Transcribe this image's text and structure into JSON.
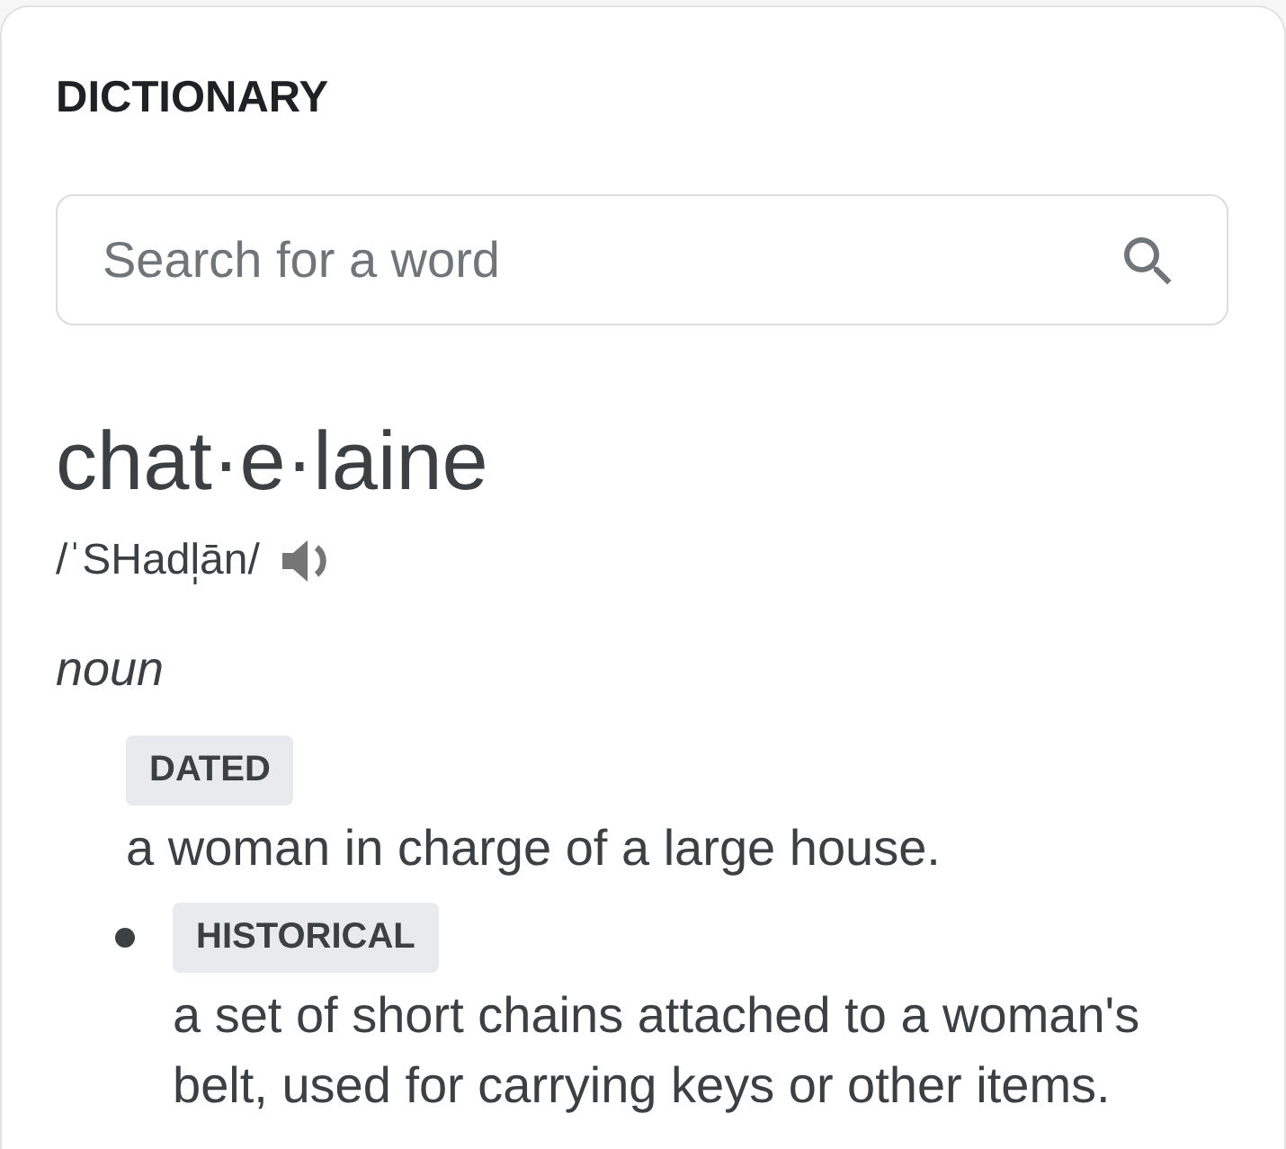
{
  "panel": {
    "title": "DICTIONARY"
  },
  "search": {
    "placeholder": "Search for a word"
  },
  "entry": {
    "headword": "chat·e·laine",
    "pronunciation": "/ˈSHadl̩ān/",
    "part_of_speech": "noun",
    "senses": [
      {
        "label": "DATED",
        "definition": "a woman in charge of a large house.",
        "children": [
          {
            "label": "HISTORICAL",
            "definition": "a set of short chains attached to a woman's belt, used for carrying keys or other items."
          }
        ]
      }
    ]
  }
}
